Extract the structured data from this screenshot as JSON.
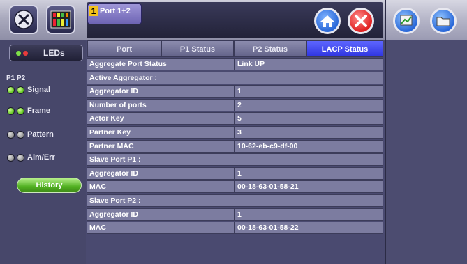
{
  "header": {
    "port_tab": {
      "number": "1",
      "label": "Port 1+2"
    },
    "icons": [
      "tools-icon",
      "equalizer-icon",
      "home-icon",
      "close-icon",
      "graph-icon",
      "folder-icon"
    ]
  },
  "sidebar": {
    "leds_label": "LEDs",
    "port_header": "P1 P2",
    "leds": [
      {
        "label": "Signal",
        "p1": "green",
        "p2": "green"
      },
      {
        "label": "Frame",
        "p1": "green",
        "p2": "green"
      },
      {
        "label": "Pattern",
        "p1": "grey",
        "p2": "grey"
      },
      {
        "label": "Alm/Err",
        "p1": "grey",
        "p2": "grey"
      }
    ],
    "history_label": "History"
  },
  "tabs": [
    {
      "label": "Port",
      "active": false
    },
    {
      "label": "P1 Status",
      "active": false
    },
    {
      "label": "P2 Status",
      "active": false
    },
    {
      "label": "LACP Status",
      "active": true
    }
  ],
  "table": {
    "rows": [
      {
        "label": "Aggregate Port Status",
        "value": "Link UP"
      },
      {
        "label": "Active Aggregator :",
        "section": true
      },
      {
        "label": "Aggregator ID",
        "value": "1"
      },
      {
        "label": "Number of ports",
        "value": "2"
      },
      {
        "label": "Actor Key",
        "value": "5"
      },
      {
        "label": "Partner Key",
        "value": "3"
      },
      {
        "label": "Partner MAC",
        "value": "10-62-eb-c9-df-00"
      },
      {
        "label": "Slave Port P1 :",
        "section": true
      },
      {
        "label": "Aggregator ID",
        "value": "1"
      },
      {
        "label": "MAC",
        "value": "00-18-63-01-58-21"
      },
      {
        "label": "Slave Port P2 :",
        "section": true
      },
      {
        "label": "Aggregator ID",
        "value": "1"
      },
      {
        "label": "MAC",
        "value": "00-18-63-01-58-22"
      }
    ]
  },
  "colors": {
    "active_tab": "#2f35e0",
    "cell_bg": "#7c7ca0",
    "led_green": "#58c018",
    "led_grey": "#8c8c8c",
    "close_red": "#e02020",
    "home_blue": "#2a68d8"
  }
}
